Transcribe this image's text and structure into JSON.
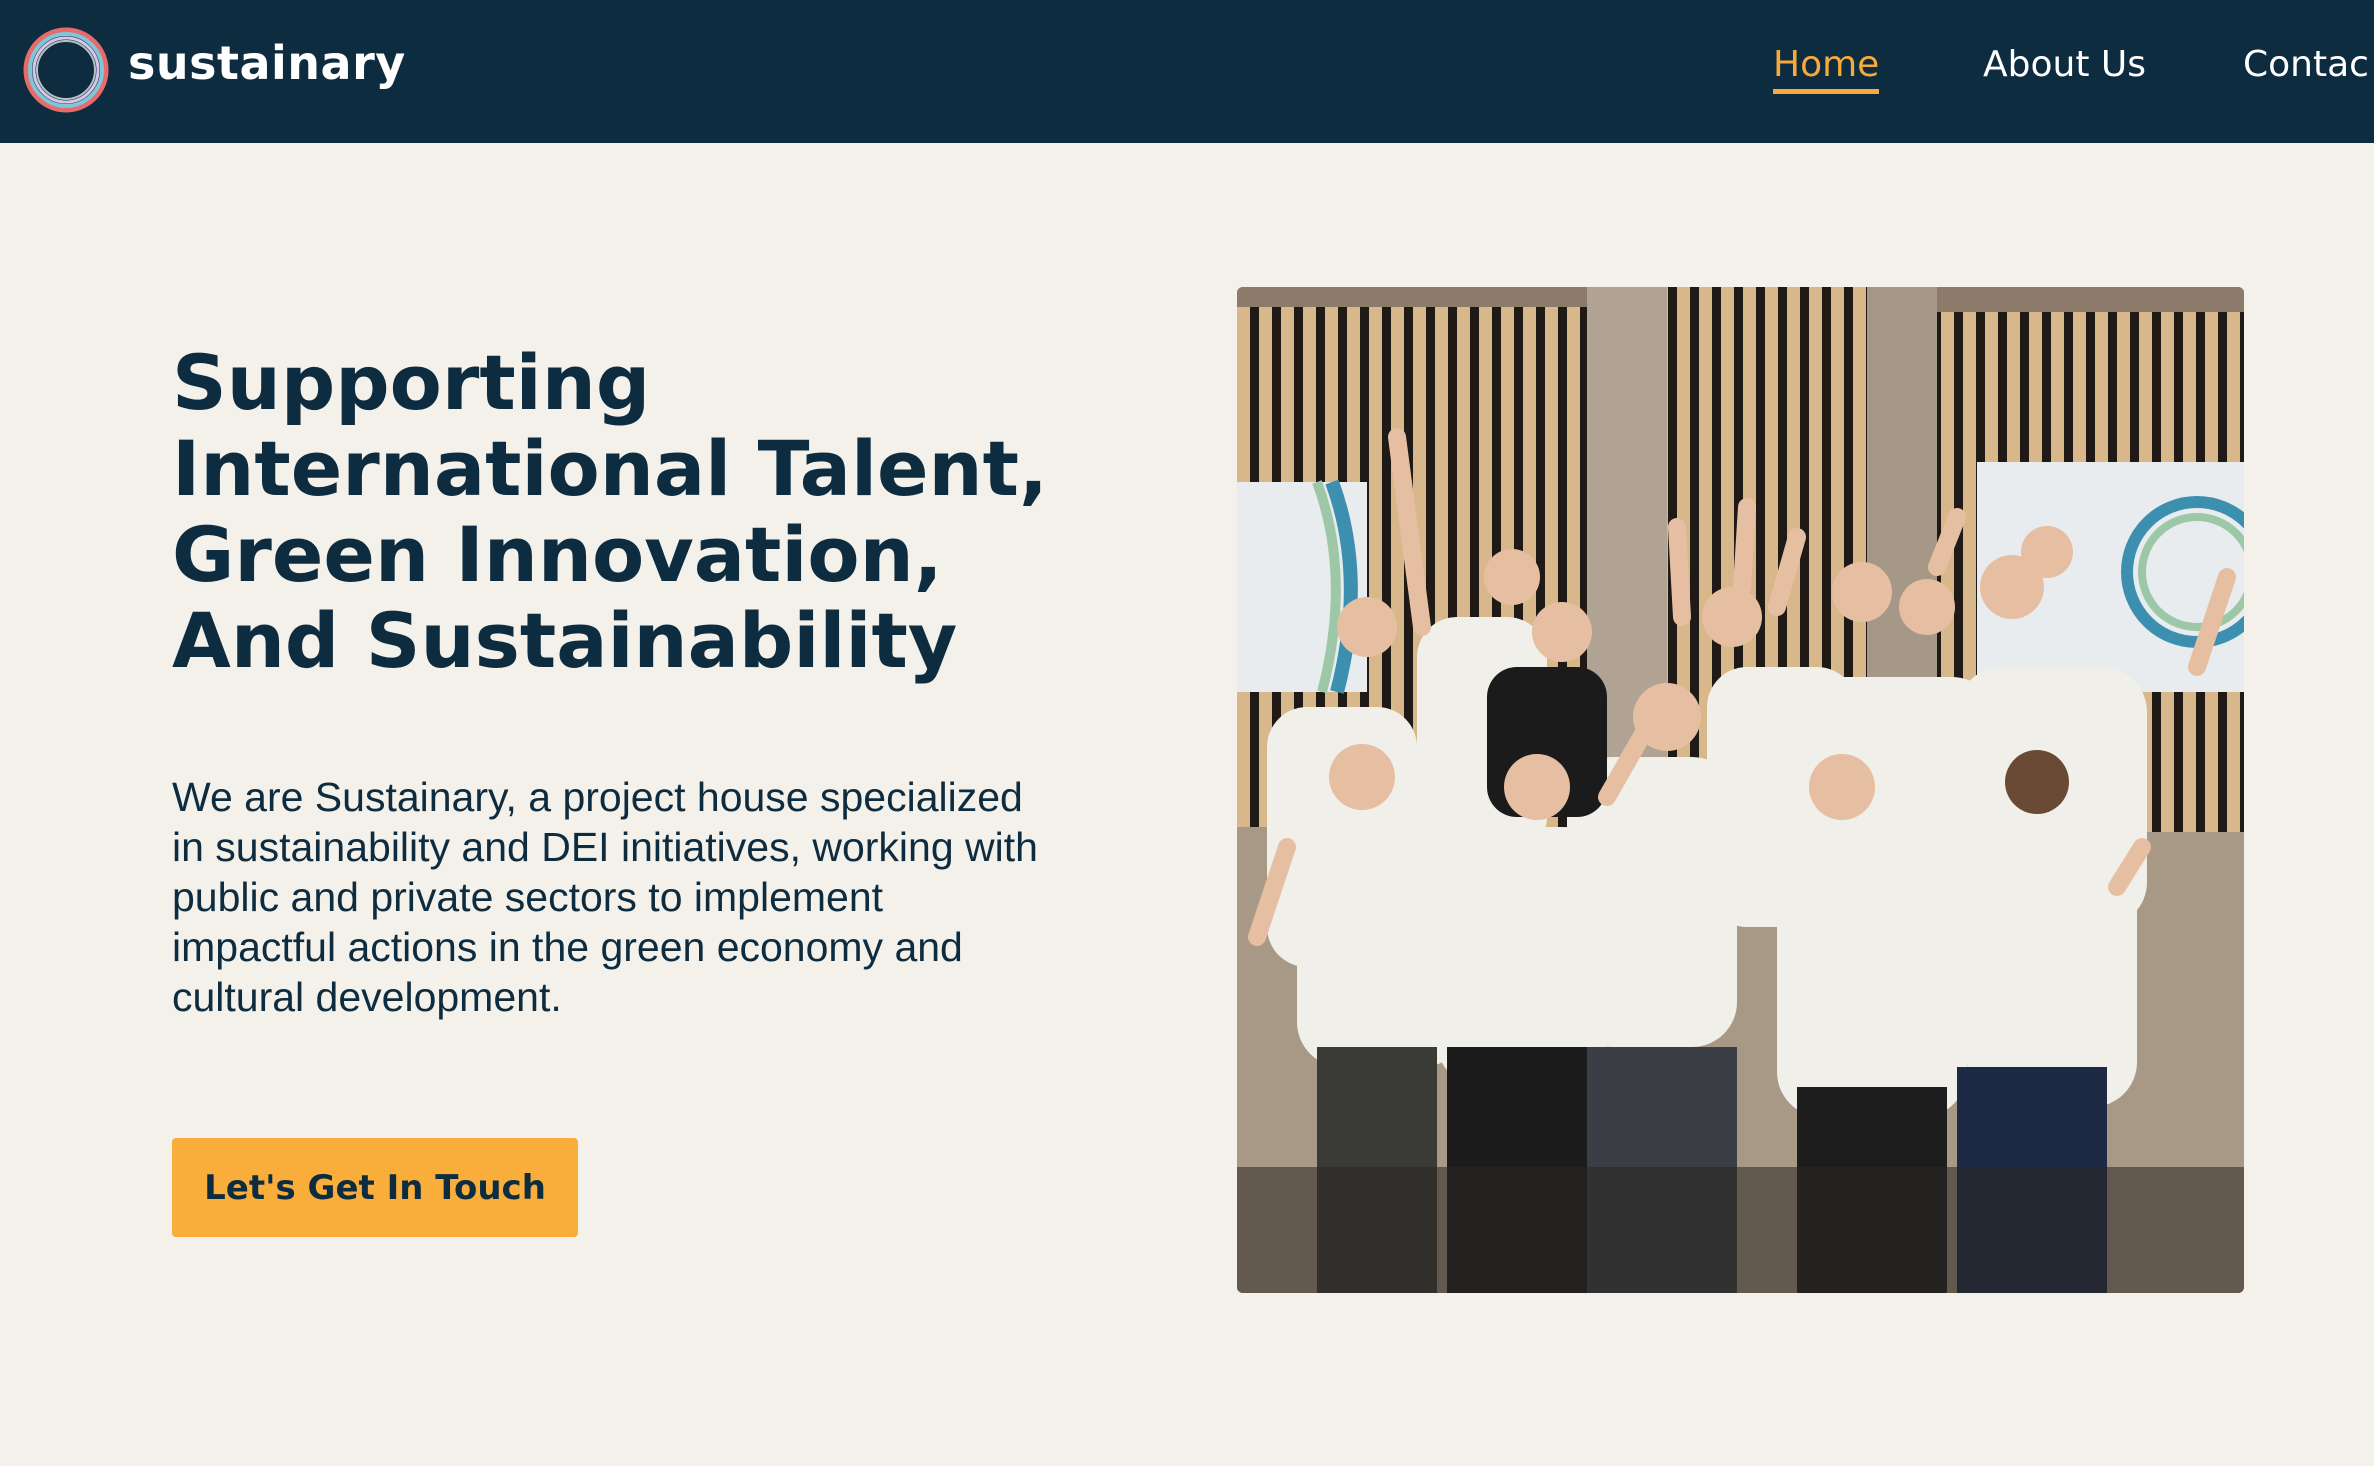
{
  "brand": {
    "name": "sustainary",
    "logo_icon": "ring-logo-icon"
  },
  "nav": {
    "items": [
      {
        "label": "Home",
        "active": true
      },
      {
        "label": "About Us",
        "active": false
      },
      {
        "label": "Contac",
        "active": false
      }
    ]
  },
  "hero": {
    "title_lines": [
      "Supporting",
      "International Talent,",
      "Green Innovation,",
      "And Sustainability"
    ],
    "description": "We are Sustainary, a project house specialized in sustainability and DEI initiatives, working with public and private sectors to implement impactful actions in the green economy and cultural development.",
    "cta_label": "Let's Get In Touch"
  },
  "colors": {
    "navy": "#0e2c40",
    "accent": "#f9ad3b",
    "background": "#f4f0ea"
  }
}
